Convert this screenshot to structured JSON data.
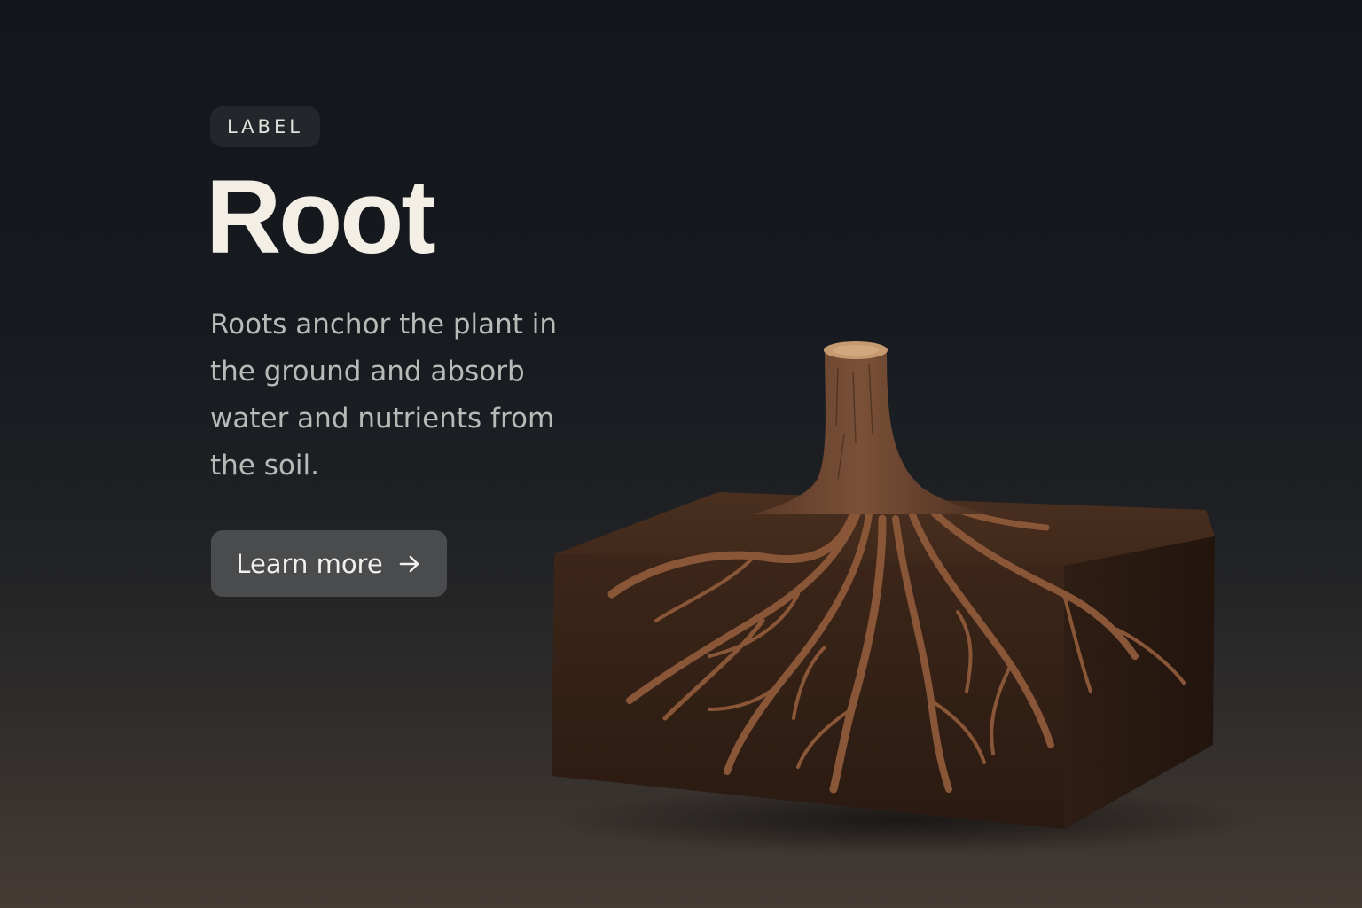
{
  "hero": {
    "label": "LABEL",
    "title": "Root",
    "description": "Roots anchor the plant in the ground and absorb water and nutrients from the soil.",
    "cta_label": "Learn more",
    "cta_icon": "arrow-right-icon"
  },
  "colors": {
    "background_top": "#13171b",
    "background_bottom": "#453b35",
    "title": "#f3efe6",
    "body_text": "#b9b9b7",
    "button_bg": "#4a4b4d",
    "soil": "#3b2418",
    "root": "#8a5638"
  }
}
